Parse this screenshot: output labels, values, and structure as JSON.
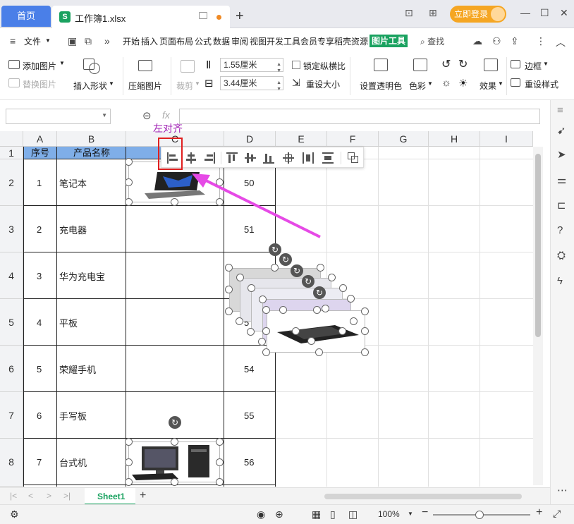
{
  "titlebar": {
    "home_tab": "首页",
    "doc_tab": "工作簿1.xlsx",
    "login_button": "立即登录"
  },
  "menubar": {
    "file_menu": "文件",
    "tabs": [
      "开始",
      "插入",
      "页面布局",
      "公式",
      "数据",
      "审阅",
      "视图",
      "开发工具",
      "会员专享",
      "稻壳资源"
    ],
    "picture_tools": "图片工具",
    "search": "查找"
  },
  "ribbon": {
    "add_picture": "添加图片",
    "replace_picture": "替换图片",
    "insert_shape": "插入形状",
    "compress_picture": "压缩图片",
    "crop": "裁剪",
    "height": "1.55厘米",
    "width": "3.44厘米",
    "lock_ratio": "锁定纵横比",
    "reset_size": "重设大小",
    "set_transparent": "设置透明色",
    "color": "色彩",
    "border": "边框",
    "effects": "效果",
    "reset_style": "重设样式"
  },
  "formula": {
    "fx_label": "fx"
  },
  "grid": {
    "columns": [
      "A",
      "B",
      "C",
      "D",
      "E",
      "F",
      "G",
      "H",
      "I"
    ],
    "rows": [
      "1",
      "2",
      "3",
      "4",
      "5",
      "6",
      "7",
      "8"
    ],
    "header_row": {
      "A": "序号",
      "B": "产品名称",
      "C": "产",
      "D": ""
    },
    "data": [
      {
        "seq": "1",
        "name": "笔记本",
        "d": "50"
      },
      {
        "seq": "2",
        "name": "充电器",
        "d": "51"
      },
      {
        "seq": "3",
        "name": "华为充电宝",
        "d": ""
      },
      {
        "seq": "4",
        "name": "平板",
        "d": "5"
      },
      {
        "seq": "5",
        "name": "荣耀手机",
        "d": "54"
      },
      {
        "seq": "6",
        "name": "手写板",
        "d": "55"
      },
      {
        "seq": "7",
        "name": "台式机",
        "d": "56"
      }
    ]
  },
  "align_toolbar": {
    "tooltip": "左对齐"
  },
  "sheetbar": {
    "active_sheet": "Sheet1"
  },
  "statusbar": {
    "zoom": "100%"
  },
  "colors": {
    "accent": "#4a7fe8",
    "picture_tools": "#1aa260",
    "annotation": "#e02020",
    "arrow": "#e64ae6",
    "header_fill": "#7faee8"
  }
}
